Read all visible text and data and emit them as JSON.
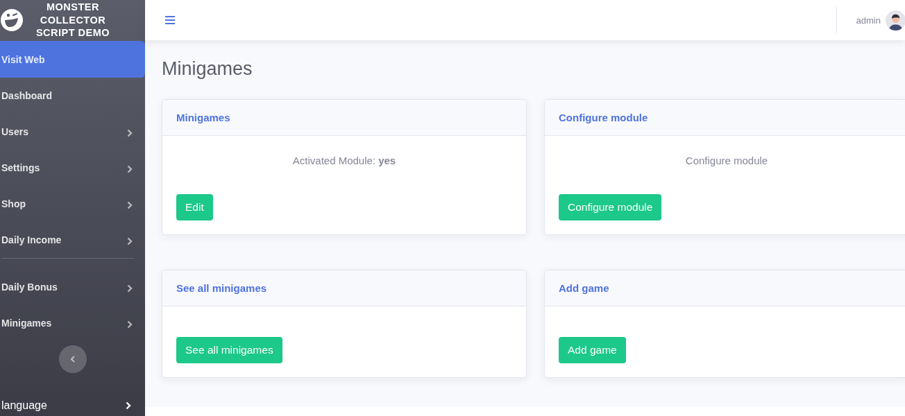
{
  "sidebar": {
    "brand": "MONSTER COLLECTOR SCRIPT DEMO",
    "sections": [
      [
        {
          "label": "Visit Web",
          "selected": true,
          "has_submenu": false
        },
        {
          "label": "Dashboard",
          "selected": false,
          "has_submenu": false
        },
        {
          "label": "Users",
          "selected": false,
          "has_submenu": true
        },
        {
          "label": "Settings",
          "selected": false,
          "has_submenu": true
        },
        {
          "label": "Shop",
          "selected": false,
          "has_submenu": true
        },
        {
          "label": "Daily Income",
          "selected": false,
          "has_submenu": true
        }
      ],
      [
        {
          "label": "Daily Bonus",
          "selected": false,
          "has_submenu": true
        },
        {
          "label": "Minigames",
          "selected": false,
          "has_submenu": true
        }
      ]
    ],
    "language": "language"
  },
  "topbar": {
    "user": "admin"
  },
  "page_title": "Minigames",
  "cards": [
    {
      "title": "Minigames",
      "text": "Activated Module: **yes**",
      "button": "Edit"
    },
    {
      "title": "Configure module",
      "text": "Configure module",
      "button": "Configure module"
    },
    {
      "title": "See all minigames",
      "button": "See all minigames"
    },
    {
      "title": "Add game",
      "button": "Add game"
    }
  ]
}
